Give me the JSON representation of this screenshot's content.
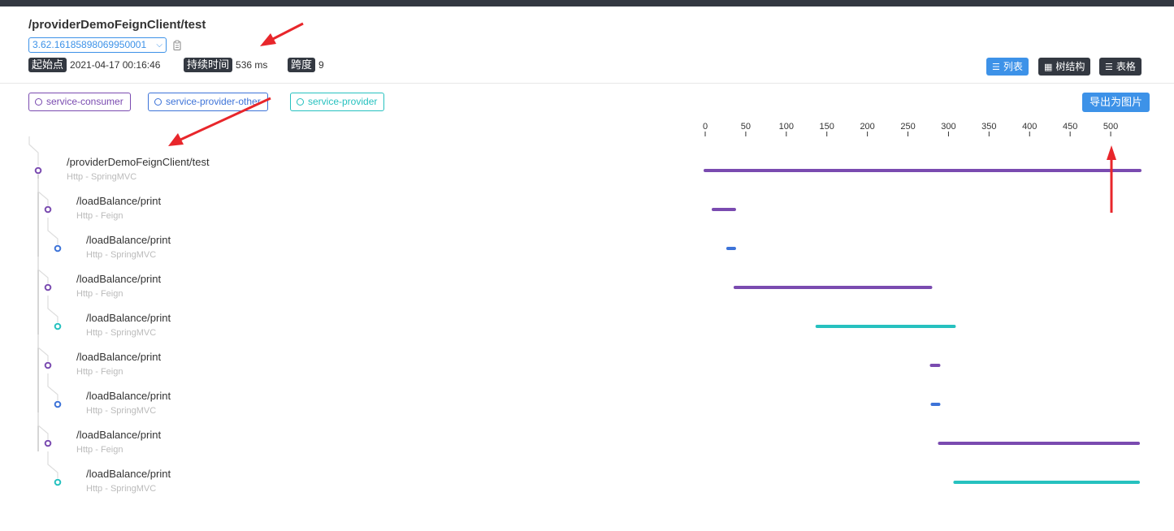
{
  "header": {
    "title": "/providerDemoFeignClient/test",
    "trace_id": "3.62.16185898069950001",
    "start_label": "起始点",
    "start_value": "2021-04-17 00:16:46",
    "duration_label": "持续时间",
    "duration_value": "536 ms",
    "span_label": "跨度",
    "span_value": "9"
  },
  "views": {
    "list_label": "列表",
    "tree_label": "树结构",
    "table_label": "表格",
    "active": "list"
  },
  "legend": [
    {
      "name": "service-consumer",
      "color": "#7a4bb0"
    },
    {
      "name": "service-provider-other",
      "color": "#3d73d8"
    },
    {
      "name": "service-provider",
      "color": "#26c1bf"
    }
  ],
  "export_label": "导出为图片",
  "axis": {
    "ticks": [
      "0",
      "50",
      "100",
      "150",
      "200",
      "250",
      "300",
      "350",
      "400",
      "450",
      "500"
    ],
    "max": 536
  },
  "spans": [
    {
      "name": "/providerDemoFeignClient/test",
      "type": "Http - SpringMVC",
      "service": 0,
      "depth": 0,
      "start": 0,
      "end": 536
    },
    {
      "name": "/loadBalance/print",
      "type": "Http - Feign",
      "service": 0,
      "depth": 1,
      "start": 10,
      "end": 36
    },
    {
      "name": "/loadBalance/print",
      "type": "Http - SpringMVC",
      "service": 1,
      "depth": 2,
      "start": 28,
      "end": 36
    },
    {
      "name": "/loadBalance/print",
      "type": "Http - Feign",
      "service": 0,
      "depth": 1,
      "start": 37,
      "end": 278
    },
    {
      "name": "/loadBalance/print",
      "type": "Http - SpringMVC",
      "service": 2,
      "depth": 2,
      "start": 138,
      "end": 307
    },
    {
      "name": "/loadBalance/print",
      "type": "Http - Feign",
      "service": 0,
      "depth": 1,
      "start": 279,
      "end": 288
    },
    {
      "name": "/loadBalance/print",
      "type": "Http - SpringMVC",
      "service": 1,
      "depth": 2,
      "start": 280,
      "end": 288
    },
    {
      "name": "/loadBalance/print",
      "type": "Http - Feign",
      "service": 0,
      "depth": 1,
      "start": 289,
      "end": 534
    },
    {
      "name": "/loadBalance/print",
      "type": "Http - SpringMVC",
      "service": 2,
      "depth": 2,
      "start": 308,
      "end": 534
    }
  ],
  "colors": {
    "accent": "#3d92e8",
    "dark": "#333841"
  }
}
